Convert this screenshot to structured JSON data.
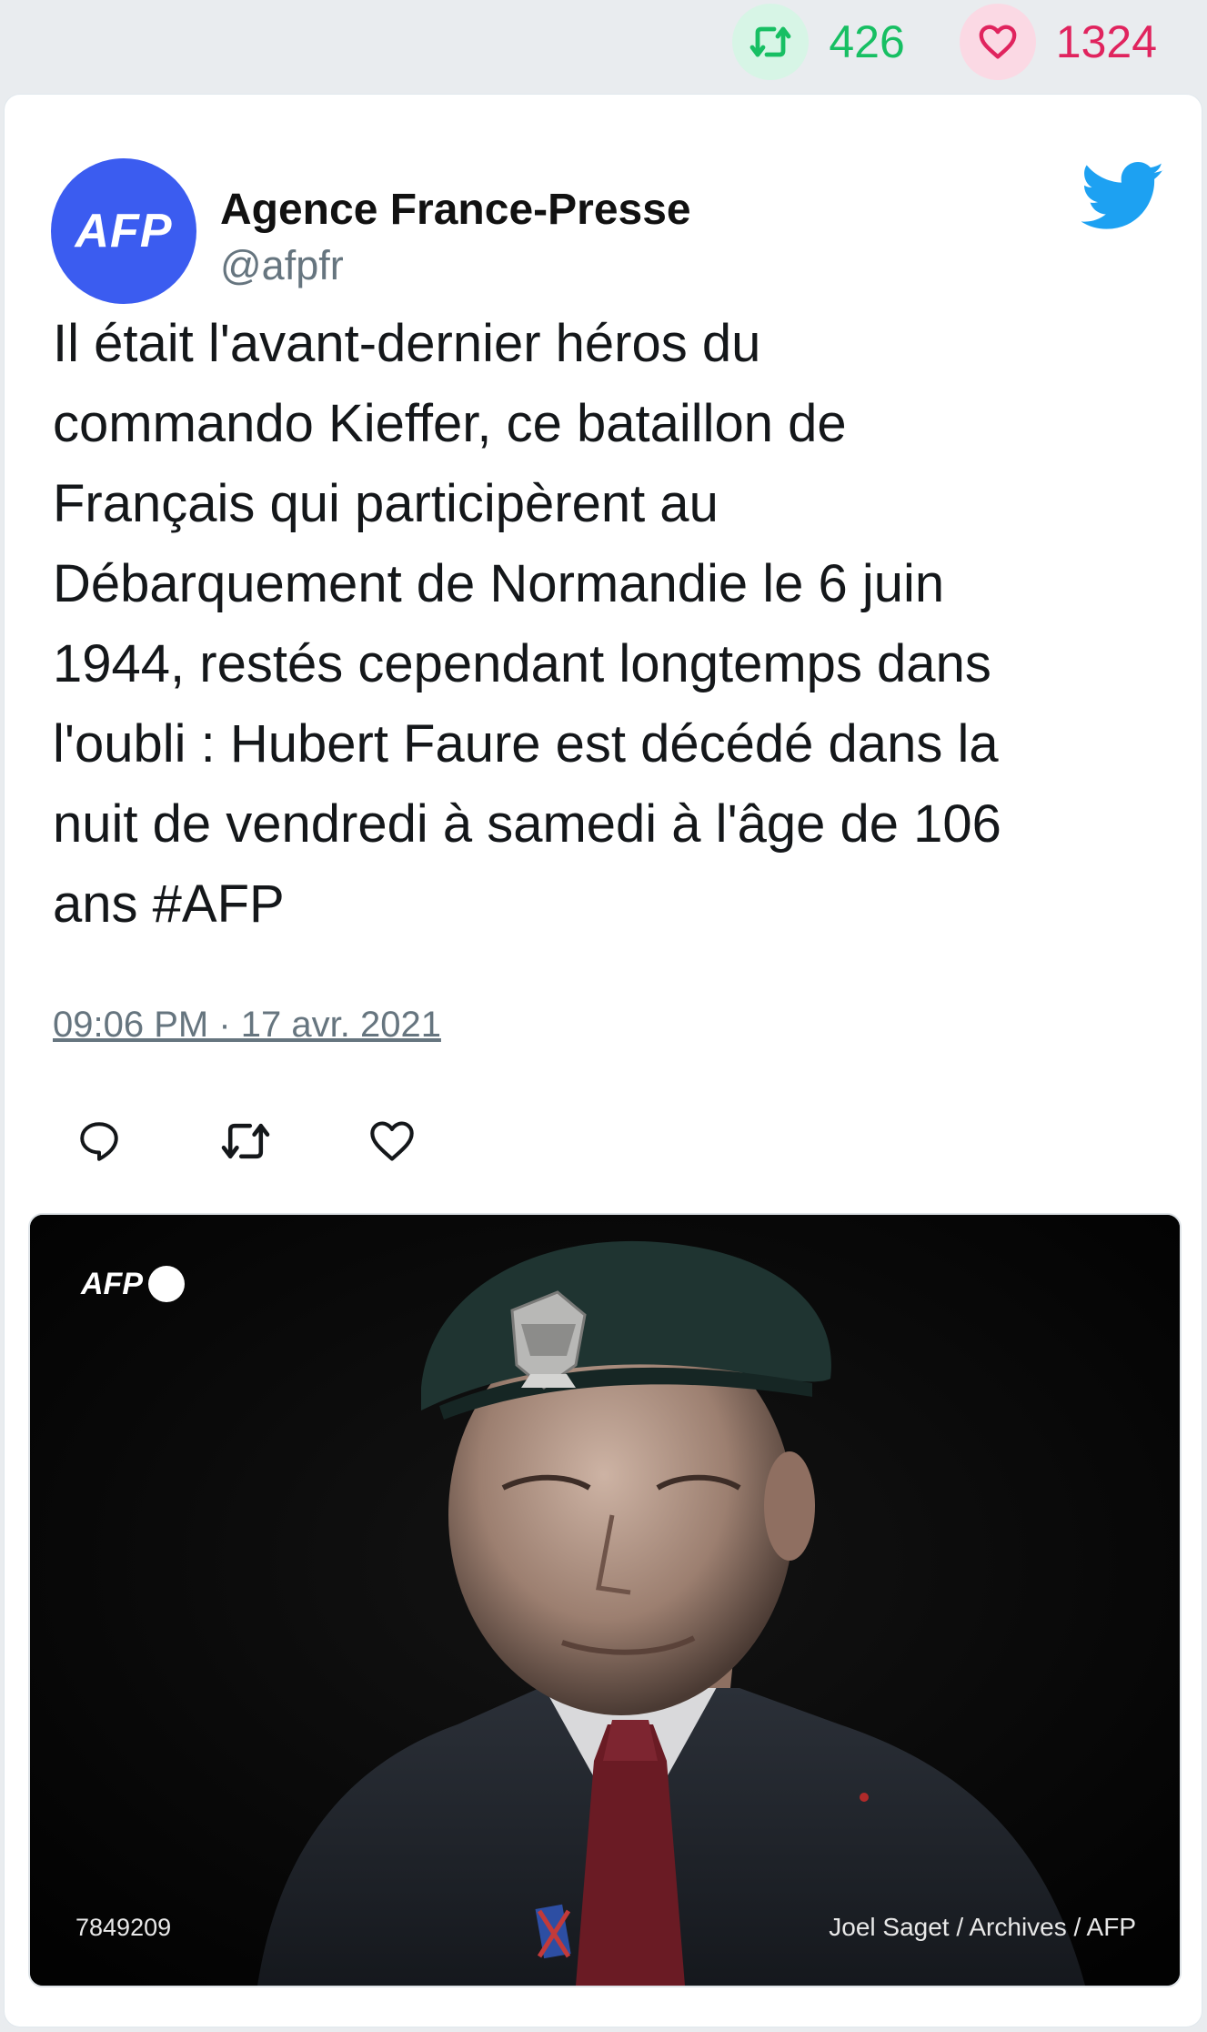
{
  "stats": {
    "retweet_icon": "retweet-icon",
    "retweets": "426",
    "like_icon": "heart-icon",
    "likes": "1324",
    "retweet_color": "#17bf63",
    "like_color": "#e0245e"
  },
  "tweet": {
    "avatar_text": "AFP",
    "author_name": "Agence France-Presse",
    "author_handle": "@afpfr",
    "brand_icon": "twitter-bird-icon",
    "brand_color": "#1da1f2",
    "text": "Il était l'avant-dernier héros du\ncommando Kieffer, ce bataillon de\nFrançais qui participèrent au\nDébarquement de Normandie le 6 juin\n1944, restés cependant longtemps dans\nl'oubli : Hubert Faure est décédé dans la\nnuit de vendredi à samedi à l'âge de 106\nans #AFP",
    "timestamp": "09:06 PM · 17 avr. 2021",
    "actions": [
      "reply-icon",
      "retweet-icon",
      "like-icon"
    ]
  },
  "media": {
    "watermark": "AFP",
    "photo_id": "7849209",
    "credit": "Joel Saget / Archives / AFP"
  }
}
